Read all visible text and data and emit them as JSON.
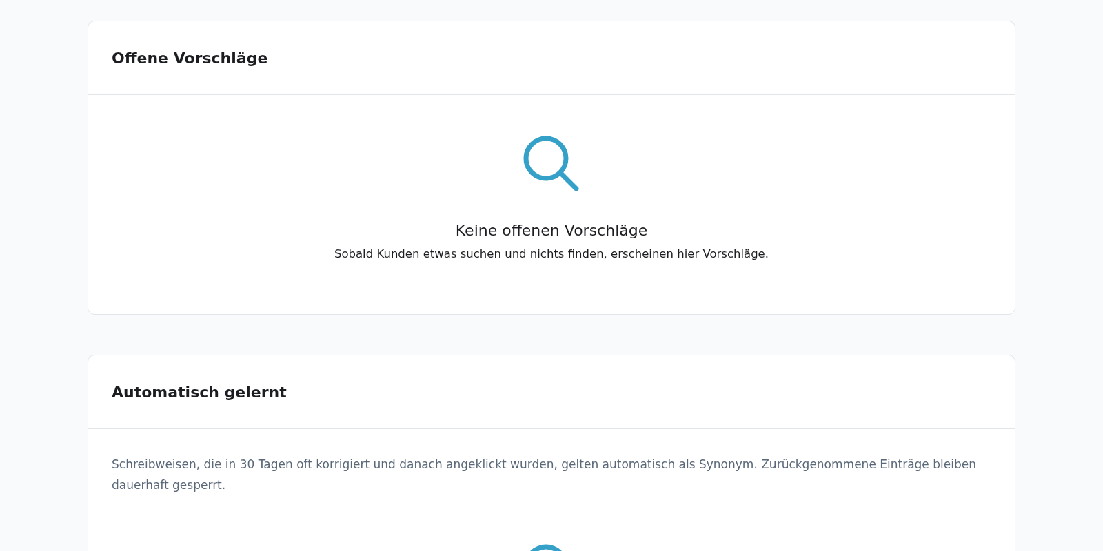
{
  "sections": [
    {
      "title": "Offene Vorschläge",
      "empty": true,
      "empty_title": "Keine offenen Vorschläge",
      "empty_text": "Sobald Kunden etwas suchen und nichts finden, erscheinen hier Vorschläge."
    },
    {
      "title": "Automatisch gelernt",
      "description": "Schreibweisen, die in 30 Tagen oft korrigiert und danach angeklickt wurden, gelten automatisch als Synonym. Zurückgenommene Einträge bleiben dauerhaft gesperrt.",
      "empty": true
    }
  ]
}
